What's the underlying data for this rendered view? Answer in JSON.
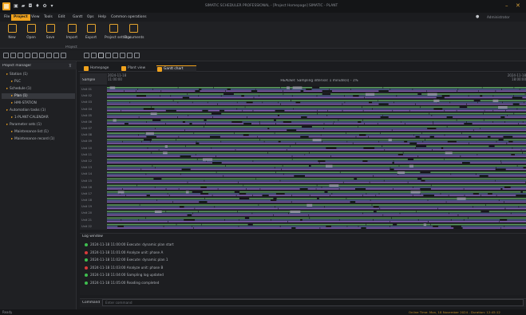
{
  "window": {
    "title": "SIMATIC SCHEDULER PROFESSIONAL - [Project Homepage] SIMATIC - PLANT"
  },
  "menu": {
    "tabs": [
      "File",
      "Project",
      "View",
      "Tools",
      "Edit",
      "Gantt",
      "Ops",
      "Help",
      "Common operations"
    ],
    "active": "Project",
    "help_icon": "help-icon",
    "user": "Administrator"
  },
  "ribbon": {
    "buttons": [
      {
        "label": "New",
        "icon": "new-project-icon"
      },
      {
        "label": "Open",
        "icon": "open-icon"
      },
      {
        "label": "Save",
        "icon": "save-icon"
      },
      {
        "label": "Import",
        "icon": "import-icon"
      },
      {
        "label": "Export",
        "icon": "export-icon"
      },
      {
        "label": "Project settings",
        "icon": "settings-icon"
      },
      {
        "label": "Documents",
        "icon": "documents-icon"
      }
    ],
    "group_label": "Project"
  },
  "left_panel": {
    "title": "Project manager",
    "tree": [
      {
        "label": "Station (1)",
        "indent": 1
      },
      {
        "label": "PLC",
        "indent": 2
      },
      {
        "label": "Schedule (1)",
        "indent": 1
      },
      {
        "label": "Plan (1)",
        "indent": 2,
        "selected": true
      },
      {
        "label": "HMI-STATION",
        "indent": 2
      },
      {
        "label": "Automation tasks (1)",
        "indent": 1
      },
      {
        "label": "1-PLANT-CALENDAR",
        "indent": 2
      },
      {
        "label": "Parameter sets (1)",
        "indent": 1
      },
      {
        "label": "Maintenance list (1)",
        "indent": 2
      },
      {
        "label": "Maintenance record (1)",
        "indent": 2
      }
    ]
  },
  "doc_tabs": [
    {
      "label": "Homepage",
      "active": false
    },
    {
      "label": "Plant view",
      "active": false
    },
    {
      "label": "Gantt chart",
      "active": true
    }
  ],
  "timeline": {
    "sample_label": "Sample",
    "start": "2024-11-18 11:00:00",
    "center": "HEADER: Sampling interval: 1 minute(s) - 1%",
    "end": "2024-11-18 18:00:00"
  },
  "gantt": {
    "rows": [
      "Unit 01",
      "Unit 02",
      "Unit 03",
      "Unit 04",
      "Unit 05",
      "Unit 06",
      "Unit 07",
      "Unit 08",
      "Unit 09",
      "Unit 10",
      "Unit 11",
      "Unit 12",
      "Unit 13",
      "Unit 14",
      "Unit 15",
      "Unit 16",
      "Unit 17",
      "Unit 18",
      "Unit 19",
      "Unit 20",
      "Unit 21",
      "Unit 22"
    ],
    "colors": {
      "running": "#5c9c5f",
      "idle": "#4a5a8a",
      "maint": "#9a6fcf",
      "stop": "#8a8e95",
      "fault": "#c04040"
    }
  },
  "log": {
    "title": "Log window",
    "entries": [
      {
        "status": "ok",
        "text": "2024-11-18 11:00:00  Execute: dynamic plan start"
      },
      {
        "status": "error",
        "text": "2024-11-18 11:01:00  Analyze unit: phase A"
      },
      {
        "status": "ok",
        "text": "2024-11-18 11:02:00  Execute: dynamic plan 1"
      },
      {
        "status": "error",
        "text": "2024-11-18 11:03:00  Analyze unit: phase B"
      },
      {
        "status": "ok",
        "text": "2024-11-18 11:04:00  Sampling log updated"
      },
      {
        "status": "ok",
        "text": "2024-11-18 11:05:00  Reading completed"
      }
    ]
  },
  "command": {
    "label": "Command",
    "placeholder": "Enter command"
  },
  "status": {
    "left": "Ready",
    "right": "Online   Time: Mon, 18 November 2024 - Duration: 12:45:12"
  }
}
